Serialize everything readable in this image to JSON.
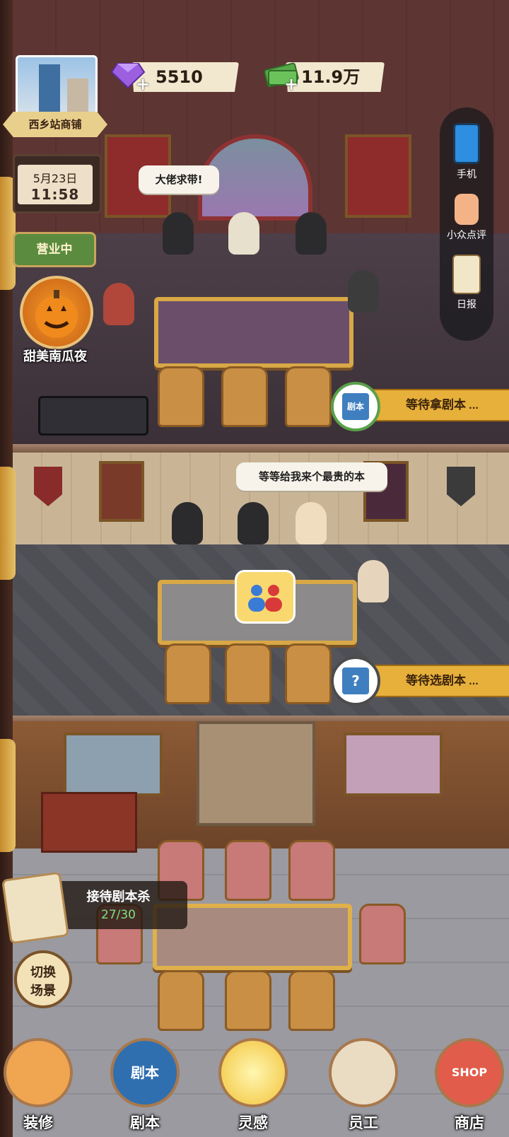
{
  "hud": {
    "store_name": "西乡站商铺",
    "gems": "5510",
    "cash": "11.9万",
    "date": "5月23日",
    "time": "11:58",
    "status_button": "营业中",
    "event_label": "甜美南瓜夜"
  },
  "right_menu": [
    {
      "label": "手机",
      "icon": "phone-icon"
    },
    {
      "label": "小众点评",
      "icon": "thumbs-up-icon"
    },
    {
      "label": "日报",
      "icon": "clipboard-icon"
    }
  ],
  "room1": {
    "speech": "大佬求带!",
    "waiting": "等待拿剧本",
    "book_label": "剧本"
  },
  "room2": {
    "speech": "等等给我来个最贵的本",
    "waiting": "等待选剧本",
    "book_label": "?"
  },
  "reception": {
    "title": "接待剧本杀",
    "count": "27/30"
  },
  "switch_scene": "切换场景",
  "nav": [
    {
      "label": "装修",
      "icon": "house-icon"
    },
    {
      "label": "剧本",
      "icon": "script-book-icon",
      "icon_text": "剧本"
    },
    {
      "label": "灵感",
      "icon": "lightbulb-icon"
    },
    {
      "label": "员工",
      "icon": "employee-card-icon"
    },
    {
      "label": "商店",
      "icon": "shop-icon",
      "icon_text": "SHOP"
    }
  ],
  "colors": {
    "accent_gold": "#e6b03b",
    "open_green": "#5b8b3e",
    "count_green": "#7ee07e"
  }
}
